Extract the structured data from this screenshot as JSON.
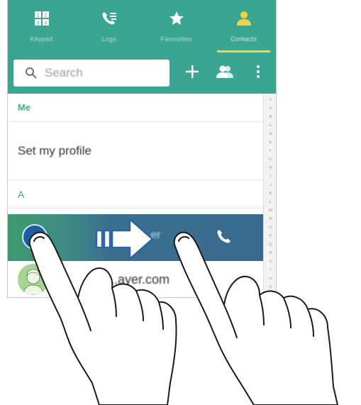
{
  "tabs": [
    {
      "label": "Keypad",
      "icon": "keypad-icon",
      "active": false
    },
    {
      "label": "Logs",
      "icon": "call-log-icon",
      "active": false
    },
    {
      "label": "Favourites",
      "icon": "star-icon",
      "active": false
    },
    {
      "label": "Contacts",
      "icon": "person-icon",
      "active": true
    }
  ],
  "search": {
    "placeholder": "Search"
  },
  "header_actions": {
    "add": "plus-icon",
    "groups": "group-icon",
    "more": "overflow-menu-icon"
  },
  "list": {
    "me_header": "Me",
    "set_profile": "Set my profile",
    "section_a": "A",
    "swipe_row_text": "...er",
    "contact_name": "...ayer.com"
  },
  "index_letters": [
    "#",
    "A",
    "B",
    "C",
    "D",
    "E",
    "F",
    "G",
    "H",
    "I",
    "J",
    "K",
    "L",
    "M",
    "N",
    "O",
    "P",
    "Q",
    "R",
    "S",
    "T",
    "U",
    "V",
    "W"
  ],
  "colors": {
    "accent": "#3aa591",
    "tab_indicator": "#f5d23f",
    "swipe_row": "#386b8e",
    "arrow": "#2d63a8"
  }
}
